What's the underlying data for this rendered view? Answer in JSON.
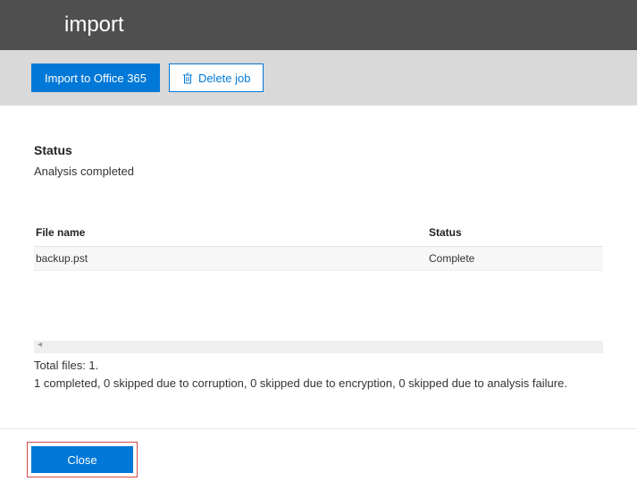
{
  "header": {
    "title": "import"
  },
  "toolbar": {
    "import_label": "Import to Office 365",
    "delete_label": "Delete job"
  },
  "status": {
    "heading": "Status",
    "text": "Analysis completed"
  },
  "grid": {
    "headers": {
      "file": "File name",
      "status": "Status"
    },
    "rows": [
      {
        "file": "backup.pst",
        "status": "Complete"
      }
    ]
  },
  "summary": {
    "line1": "Total files: 1.",
    "line2": "1 completed, 0 skipped due to corruption, 0 skipped due to encryption, 0 skipped due to analysis failure."
  },
  "footer": {
    "close_label": "Close"
  }
}
